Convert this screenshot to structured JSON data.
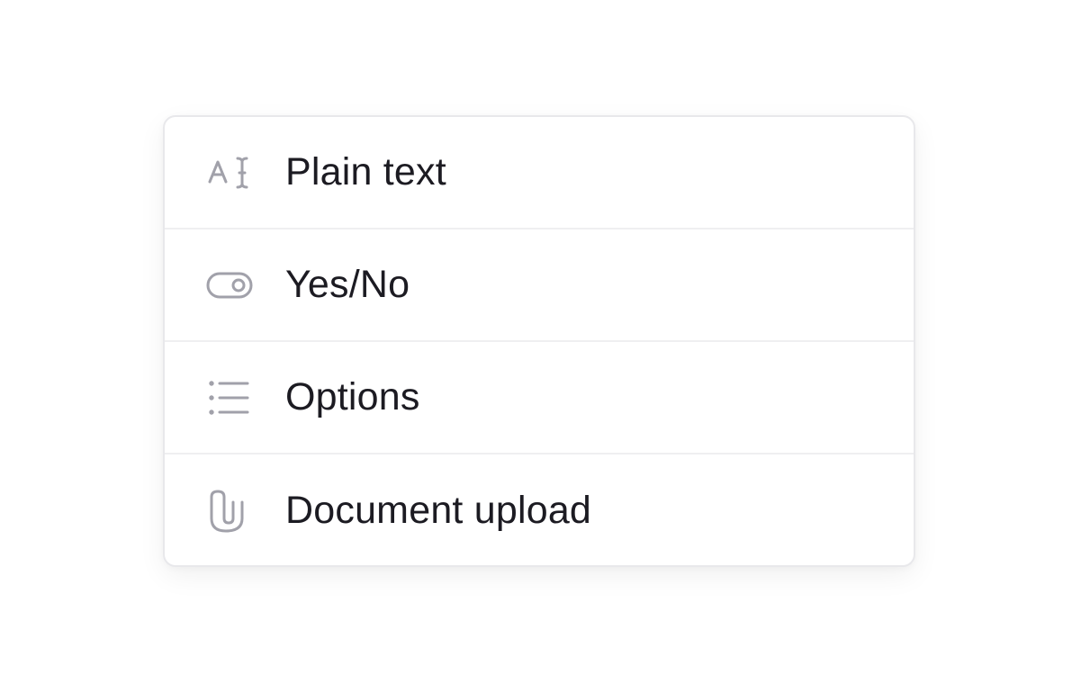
{
  "menu": {
    "items": [
      {
        "label": "Plain text",
        "icon": "text-cursor-icon"
      },
      {
        "label": "Yes/No",
        "icon": "toggle-icon"
      },
      {
        "label": "Options",
        "icon": "list-icon"
      },
      {
        "label": "Document upload",
        "icon": "paperclip-icon"
      }
    ]
  },
  "colors": {
    "icon": "#a1a1aa",
    "text": "#1c1b22",
    "border": "#e8e8eb"
  }
}
